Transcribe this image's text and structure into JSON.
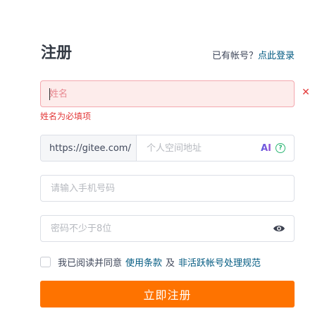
{
  "form": {
    "title": "注册",
    "login_prompt": "已有帐号？",
    "login_link": "点此登录",
    "name": {
      "value": "",
      "placeholder": "姓名",
      "error": "姓名为必填项"
    },
    "space": {
      "prefix": "https://gitee.com/",
      "value": "",
      "placeholder": "个人空间地址",
      "ai_label": "AI",
      "help_label": "?"
    },
    "phone": {
      "value": "",
      "placeholder": "请输入手机号码"
    },
    "password": {
      "value": "",
      "placeholder": "密码不少于8位"
    },
    "agreement": {
      "text": "我已阅读并同意",
      "terms_link": "使用条款",
      "and": "及",
      "inactive_link": "非活跃帐号处理规范",
      "checked": false
    },
    "submit_label": "立即注册"
  },
  "colors": {
    "accent": "#fe7300",
    "link": "#005980",
    "error": "#e33a3a",
    "help": "#2bb673"
  }
}
